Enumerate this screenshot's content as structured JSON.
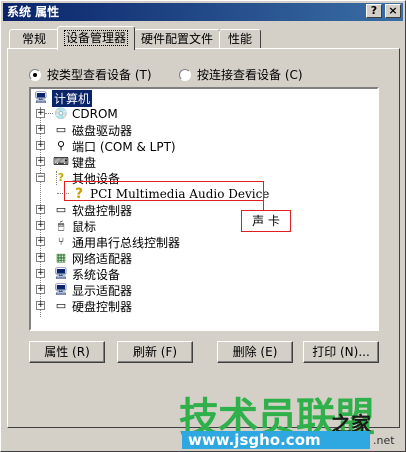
{
  "window": {
    "title": "系统 属性",
    "help": "?",
    "close": "×"
  },
  "tabs": [
    "常规",
    "设备管理器",
    "硬件配置文件",
    "性能"
  ],
  "view": {
    "by_type": "按类型查看设备 (T)",
    "by_connection": "按连接查看设备 (C)"
  },
  "tree": {
    "root": "计算机",
    "items": [
      "CDROM",
      "磁盘驱动器",
      "端口 (COM & LPT)",
      "键盘",
      "其他设备",
      "软盘控制器",
      "鼠标",
      "通用串行总线控制器",
      "网络适配器",
      "系统设备",
      "显示适配器",
      "硬盘控制器"
    ],
    "child": "PCI Multimedia Audio Device"
  },
  "annotation": "声 卡",
  "buttons": [
    "属性 (R)",
    "刷新 (F)",
    "删除 (E)",
    "打印 (N)..."
  ],
  "watermark": {
    "brand": "技术员联盟",
    "sub": "之家",
    "url": "www.jsgho.com",
    "net": ".net"
  }
}
